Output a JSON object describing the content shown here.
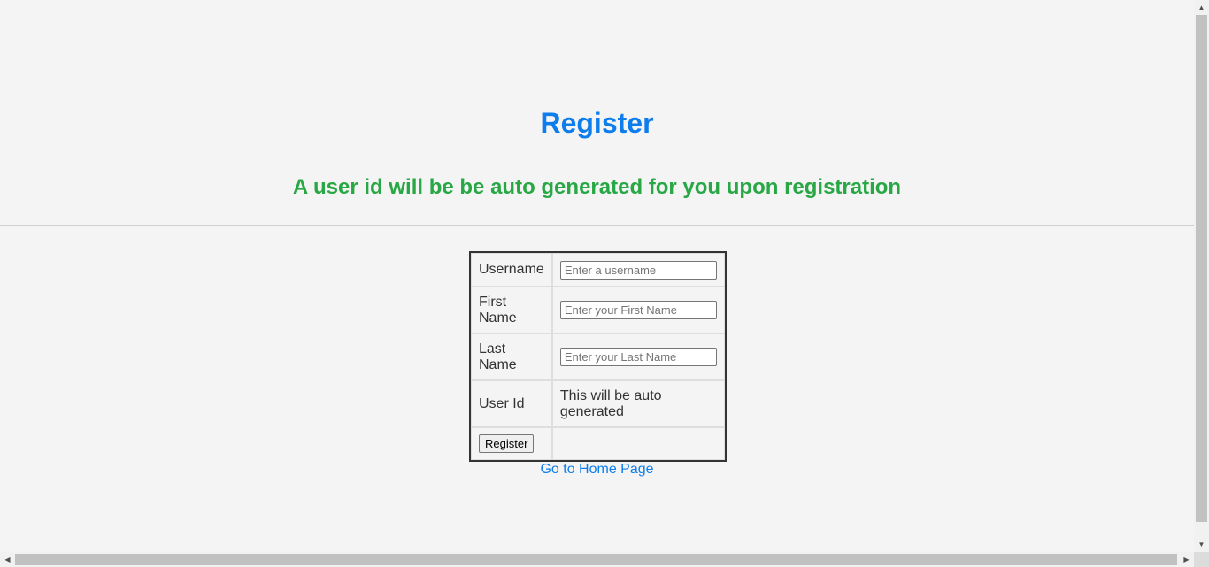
{
  "header": {
    "title": "Register",
    "subtitle": "A user id will be be auto generated for you upon registration"
  },
  "form": {
    "username_label": "Username",
    "username_placeholder": "Enter a username",
    "first_name_label": "First Name",
    "first_name_placeholder": "Enter your First Name",
    "last_name_label": "Last Name",
    "last_name_placeholder": "Enter your Last Name",
    "user_id_label": "User Id",
    "user_id_value": "This will be auto generated",
    "register_button": "Register"
  },
  "links": {
    "home": "Go to Home Page"
  },
  "colors": {
    "title": "#0d7ded",
    "subtitle": "#28a745",
    "link": "#0d7ded",
    "background": "#f4f4f4"
  },
  "icons": {
    "scroll_up": "triangle-up-icon",
    "scroll_down": "triangle-down-icon",
    "scroll_left": "triangle-left-icon",
    "scroll_right": "triangle-right-icon"
  }
}
